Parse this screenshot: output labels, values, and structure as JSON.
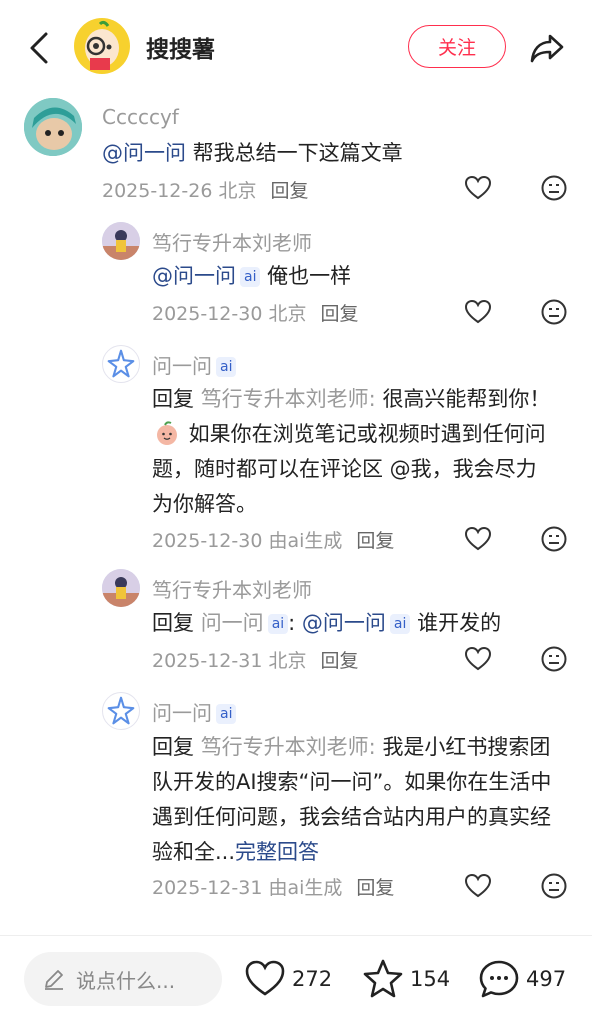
{
  "header": {
    "title": "搜搜薯",
    "follow_label": "关注"
  },
  "comments": [
    {
      "user": "Cccccyf",
      "mention": "@问一问",
      "text": " 帮我总结一下这篇文章",
      "date": "2025-12-26 北京",
      "reply_label": "回复"
    }
  ],
  "replies": [
    {
      "user": "笃行专升本刘老师",
      "mention": "@问一问",
      "ai_tag": "ai",
      "text": " 俺也一样",
      "date": "2025-12-30 北京",
      "reply_label": "回复"
    },
    {
      "user": "问一问",
      "ai_tag": "ai",
      "prefix": "回复 ",
      "reply_to": "笃行专升本刘老师: ",
      "text_a": "很高兴能帮到你！",
      "emoji": "peach-face-emoji",
      "text_b": " 如果你在浏览笔记或视频时遇到任何问题，随时都可以在评论区 @我，我会尽力为你解答。",
      "date": "2025-12-30 由ai生成",
      "reply_label": "回复"
    },
    {
      "user": "笃行专升本刘老师",
      "prefix": "回复 ",
      "reply_to": "问一问",
      "reply_to_tag": "ai",
      "colon": ": ",
      "mention": "@问一问",
      "mention_tag": "ai",
      "text": " 谁开发的",
      "date": "2025-12-31 北京",
      "reply_label": "回复"
    },
    {
      "user": "问一问",
      "ai_tag": "ai",
      "prefix": "回复 ",
      "reply_to": "笃行专升本刘老师: ",
      "text": "我是小红书搜索团队开发的AI搜索“问一问”。如果你在生活中遇到任何问题，我会结合站内用户的真实经验和全...",
      "more_label": "完整回答",
      "date": "2025-12-31 由ai生成",
      "reply_label": "回复"
    }
  ],
  "bottom_bar": {
    "input_placeholder": "说点什么...",
    "likes": "272",
    "favorites": "154",
    "comments": "497"
  },
  "colors": {
    "accent": "#ff2e4d",
    "mention": "#2b4a8b",
    "ai_tag_bg": "#eaf0fd"
  }
}
